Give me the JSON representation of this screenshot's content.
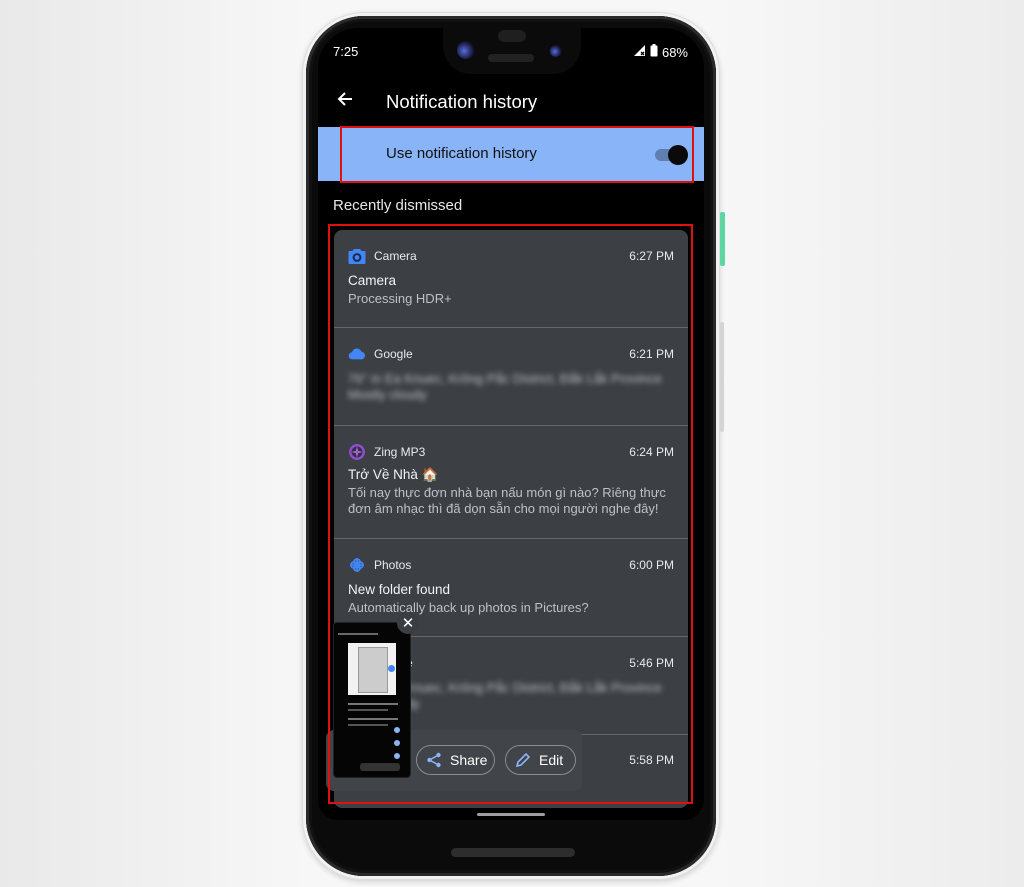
{
  "status_bar": {
    "time": "7:25",
    "battery": "68%",
    "icons": [
      "signal-no-data-icon",
      "battery-icon"
    ]
  },
  "header": {
    "back_icon": "arrow-left-icon",
    "title": "Notification history"
  },
  "setting": {
    "label": "Use notification history",
    "enabled": true
  },
  "section": {
    "title": "Recently dismissed"
  },
  "notifications": [
    {
      "app": "Camera",
      "icon": "camera-icon",
      "time": "6:27 PM",
      "title": "Camera",
      "text": "Processing HDR+",
      "blurred": false
    },
    {
      "app": "Google",
      "icon": "cloud-icon",
      "time": "6:21 PM",
      "title": "",
      "text": "76° in Ea Knuec, Krông Pắc District, Đắk Lắk Province\nMostly cloudy",
      "blurred": true
    },
    {
      "app": "Zing MP3",
      "icon": "zing-disc-icon",
      "time": "6:24 PM",
      "title": "Trở Về Nhà 🏠",
      "text": "Tối nay thực đơn nhà bạn nấu món gì nào? Riêng thực đơn âm nhạc thì đã dọn sẵn cho mọi người nghe đây!",
      "blurred": false
    },
    {
      "app": "Photos",
      "icon": "pinwheel-icon",
      "time": "6:00 PM",
      "title": "New folder found",
      "text": "Automatically back up photos in Pictures?",
      "blurred": false
    },
    {
      "app": "Google",
      "icon": "cloud-icon",
      "time": "5:46 PM",
      "title": "",
      "text": "76° in Ea Knuec, Krông Pắc District, Đắk Lắk Province\n32° · Cloudy",
      "blurred": true
    },
    {
      "app": "",
      "icon": "",
      "time": "5:58 PM",
      "title": "",
      "text": "",
      "blurred": true
    }
  ],
  "screenshot_overlay": {
    "close_icon": "close-icon",
    "share_label": "Share",
    "share_icon": "share-icon",
    "edit_label": "Edit",
    "edit_icon": "pencil-icon"
  },
  "colors": {
    "toggle_row_bg": "#8ab4f8",
    "card_bg": "#3c3f43",
    "highlight_border": "#e01010",
    "google_blue": "#4285f4",
    "zing_purple": "#8e4fc8"
  }
}
